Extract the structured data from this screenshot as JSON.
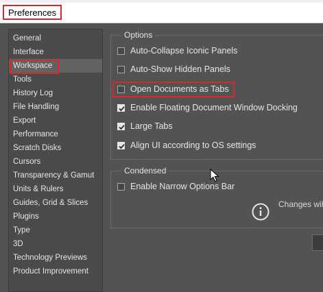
{
  "window": {
    "title": "Preferences"
  },
  "sidebar": {
    "items": [
      {
        "label": "General"
      },
      {
        "label": "Interface"
      },
      {
        "label": "Workspace"
      },
      {
        "label": "Tools"
      },
      {
        "label": "History Log"
      },
      {
        "label": "File Handling"
      },
      {
        "label": "Export"
      },
      {
        "label": "Performance"
      },
      {
        "label": "Scratch Disks"
      },
      {
        "label": "Cursors"
      },
      {
        "label": "Transparency & Gamut"
      },
      {
        "label": "Units & Rulers"
      },
      {
        "label": "Guides, Grid & Slices"
      },
      {
        "label": "Plugins"
      },
      {
        "label": "Type"
      },
      {
        "label": "3D"
      },
      {
        "label": "Technology Previews"
      },
      {
        "label": "Product Improvement"
      }
    ],
    "selected": "Workspace"
  },
  "options": {
    "title": "Options",
    "items": [
      {
        "label": "Auto-Collapse Iconic Panels",
        "checked": false
      },
      {
        "label": "Auto-Show Hidden Panels",
        "checked": false
      },
      {
        "label": "Open Documents as Tabs",
        "checked": false
      },
      {
        "label": "Enable Floating Document Window Docking",
        "checked": true
      },
      {
        "label": "Large Tabs",
        "checked": true
      },
      {
        "label": "Align UI according to OS settings",
        "checked": true
      }
    ]
  },
  "condensed": {
    "title": "Condensed",
    "items": [
      {
        "label": "Enable Narrow Options Bar",
        "checked": false
      }
    ],
    "info_text": "Changes wil"
  },
  "colors": {
    "highlight": "#e0242c",
    "panel_bg": "#535353"
  }
}
